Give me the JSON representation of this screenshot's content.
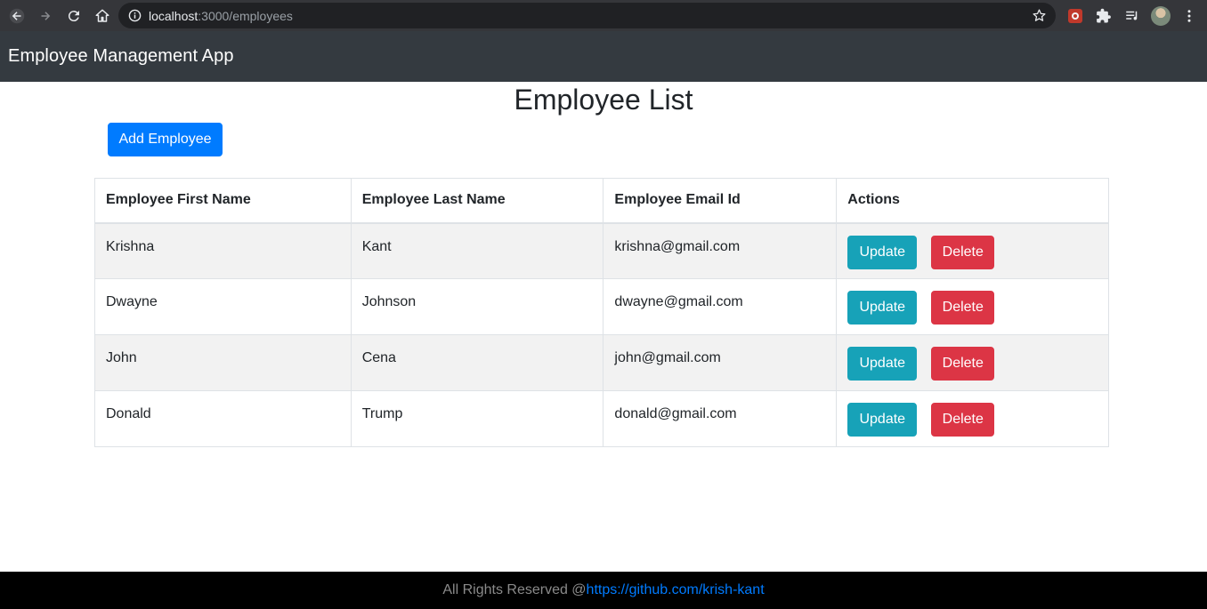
{
  "browser": {
    "url_host": "localhost",
    "url_path": ":3000/employees",
    "icons": [
      "back-icon",
      "forward-icon",
      "reload-icon",
      "home-icon",
      "info-icon",
      "star-icon",
      "extension-icon",
      "puzzle-icon",
      "reading-list-icon",
      "profile-avatar",
      "menu-icon"
    ]
  },
  "navbar": {
    "brand": "Employee Management App"
  },
  "main": {
    "title": "Employee List",
    "add_button": "Add Employee",
    "table": {
      "headers": [
        "Employee First Name",
        "Employee Last Name",
        "Employee Email Id",
        "Actions"
      ],
      "rows": [
        {
          "first_name": "Krishna",
          "last_name": "Kant",
          "email": "krishna@gmail.com"
        },
        {
          "first_name": "Dwayne",
          "last_name": "Johnson",
          "email": "dwayne@gmail.com"
        },
        {
          "first_name": "John",
          "last_name": "Cena",
          "email": "john@gmail.com"
        },
        {
          "first_name": "Donald",
          "last_name": "Trump",
          "email": "donald@gmail.com"
        }
      ],
      "update_label": "Update",
      "delete_label": "Delete"
    }
  },
  "footer": {
    "text": "All Rights Reserved @",
    "link": "https://github.com/krish-kant"
  },
  "colors": {
    "navbar": "#343a40",
    "primary": "#007bff",
    "info": "#17a2b8",
    "danger": "#dc3545",
    "footer": "#000000"
  }
}
